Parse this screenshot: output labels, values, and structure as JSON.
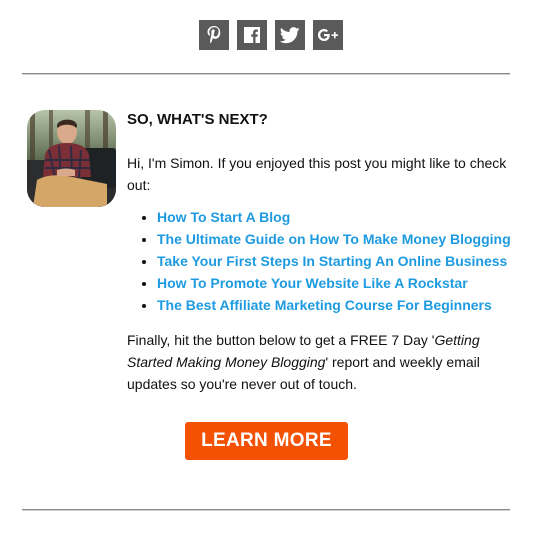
{
  "share": {
    "buttons": [
      {
        "icon": "pinterest-icon",
        "label": "Pinterest"
      },
      {
        "icon": "facebook-icon",
        "label": "Facebook"
      },
      {
        "icon": "twitter-icon",
        "label": "Twitter"
      },
      {
        "icon": "google-plus-icon",
        "label": "G+"
      }
    ],
    "color": "#5a5a5a"
  },
  "author_box": {
    "avatar_alt": "Simon",
    "heading": "SO, WHAT'S NEXT?",
    "intro": "Hi, I'm Simon. If you enjoyed this post you might like to check out:",
    "links": [
      "How To Start A Blog",
      "The Ultimate Guide on How To Make Money Blogging",
      "Take Your First Steps In Starting An Online Business",
      "How To Promote Your Website Like A Rockstar",
      "The Best Affiliate Marketing Course For Beginners"
    ],
    "link_color": "#1e9be0",
    "outro_before": "Finally, hit the button below to get a FREE 7 Day '",
    "outro_italic": "Getting Started Making Money Blogging",
    "outro_after": "' report and weekly email updates so you're never out of touch.",
    "cta_label": "LEARN MORE",
    "cta_color": "#f35104"
  }
}
